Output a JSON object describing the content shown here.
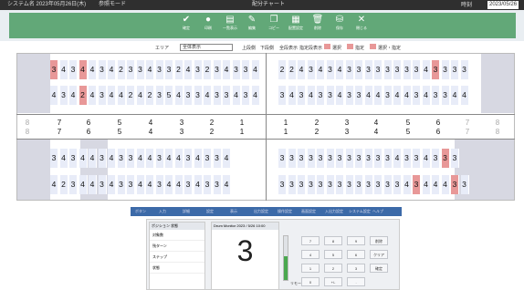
{
  "titlebar": {
    "left_text": "システム名 2023年05月26日(木)",
    "mid_text": "参照モード",
    "center_text": "配分チャート",
    "clock": "時刻",
    "date": "2023/05/26"
  },
  "toolbar": {
    "buttons": [
      {
        "label": "確定",
        "icon": "check-icon",
        "glyph": "✔"
      },
      {
        "label": "印刷",
        "icon": "circle-icon",
        "glyph": "●"
      },
      {
        "label": "一覧表示",
        "icon": "list-icon",
        "glyph": "▤"
      },
      {
        "label": "編集",
        "icon": "edit-icon",
        "glyph": "✎"
      },
      {
        "label": "コピー",
        "icon": "copy-icon",
        "glyph": "❐"
      },
      {
        "label": "配置設定",
        "icon": "grid-icon",
        "glyph": "▦"
      },
      {
        "label": "削除",
        "icon": "trash-icon",
        "glyph": "🗑"
      },
      {
        "label": "保存",
        "icon": "save-icon",
        "glyph": "⛁"
      },
      {
        "label": "閉じる",
        "icon": "close-icon",
        "glyph": "✕"
      }
    ]
  },
  "filter": {
    "label": "エリア",
    "selected": "全体表示",
    "options": [
      "上段側",
      "下段側",
      "全段表示",
      "指定段表示"
    ],
    "legend": [
      {
        "label": "選択",
        "color": "#e89898"
      },
      {
        "label": "指定",
        "color": "#e89898"
      },
      {
        "label": "選択・指定",
        "color": "#e89898"
      }
    ]
  },
  "board": {
    "top_row1_left": [
      "3",
      "4",
      "3",
      "4",
      "4",
      "3",
      "4",
      "2",
      "3",
      "3",
      "4",
      "3",
      "3",
      "2",
      "4",
      "3",
      "2",
      "3",
      "4",
      "3",
      "3",
      "4"
    ],
    "top_row2_left": [
      "4",
      "3",
      "4",
      "2",
      "4",
      "3",
      "4",
      "4",
      "2",
      "4",
      "2",
      "3",
      "5",
      "4",
      "3",
      "3",
      "4",
      "3",
      "3",
      "4",
      "3",
      "4"
    ],
    "top_row1_right": [
      "2",
      "2",
      "4",
      "3",
      "4",
      "3",
      "4",
      "3",
      "3",
      "3",
      "3",
      "3",
      "3",
      "3",
      "3",
      "4",
      "3",
      "3",
      "3",
      "3"
    ],
    "top_row2_right": [
      "3",
      "4",
      "3",
      "4",
      "3",
      "3",
      "4",
      "3",
      "3",
      "4",
      "4",
      "3",
      "4",
      "4",
      "3",
      "4",
      "3",
      "3",
      "4",
      "4"
    ],
    "bottom_row1_left": [
      "3",
      "4",
      "3",
      "4",
      "4",
      "3",
      "4",
      "3",
      "3",
      "4",
      "4",
      "3",
      "4",
      "4",
      "3",
      "4",
      "3",
      "3",
      "4"
    ],
    "bottom_row2_left": [
      "4",
      "2",
      "3",
      "4",
      "4",
      "3",
      "4",
      "3",
      "3",
      "4",
      "4",
      "3",
      "4",
      "4",
      "3",
      "4",
      "3",
      "3",
      "4"
    ],
    "bottom_row1_right": [
      "3",
      "3",
      "3",
      "3",
      "3",
      "3",
      "3",
      "3",
      "3",
      "3",
      "3",
      "3",
      "4",
      "3",
      "3",
      "4",
      "3",
      "3",
      "3"
    ],
    "bottom_row2_right": [
      "3",
      "3",
      "3",
      "3",
      "3",
      "3",
      "3",
      "3",
      "3",
      "3",
      "3",
      "3",
      "3",
      "4",
      "3",
      "4",
      "4",
      "4",
      "3",
      "3"
    ],
    "scale_left": [
      "8",
      "7",
      "6",
      "5",
      "4",
      "3",
      "2",
      "1"
    ],
    "scale_right": [
      "1",
      "2",
      "3",
      "4",
      "5",
      "6",
      "7",
      "8"
    ]
  },
  "tabs": [
    "ボタン",
    "入力",
    "詳細",
    "設定",
    "表示",
    "出力設定",
    "操作設定",
    "画面設定",
    "入出力設定",
    "システム設定",
    "ヘルプ"
  ],
  "panel": {
    "list_header": "ポジション 状態",
    "list_rows": [
      "対象数",
      "残ターン",
      "ステップ",
      "状態"
    ],
    "display_header": "Drum Monitor 2023 / 5/26 10:00",
    "display_value": "3",
    "gauge_level": 0.55,
    "gauge_label": "リモート",
    "keys": [
      "7",
      "8",
      "9",
      "削除",
      "4",
      "5",
      "6",
      "クリア",
      "1",
      "2",
      "3",
      "確定",
      "0",
      "+/-",
      "."
    ]
  }
}
